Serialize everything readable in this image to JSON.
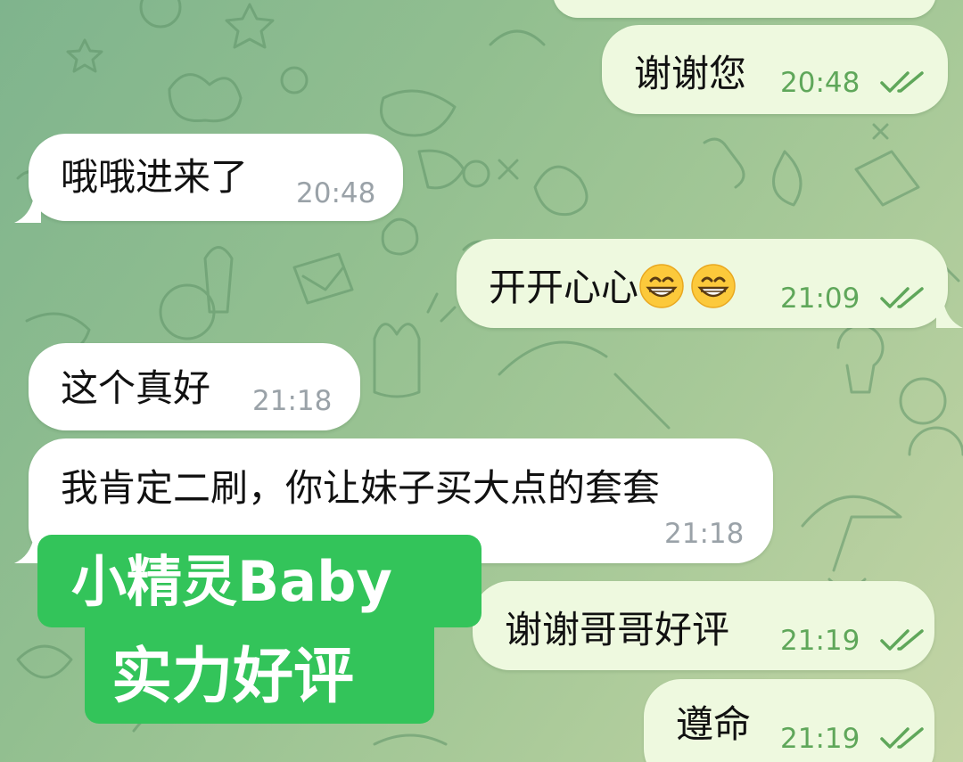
{
  "chat": {
    "messages": [
      {
        "direction": "out",
        "text": "谢谢您",
        "time": "20:48",
        "read": true
      },
      {
        "direction": "in",
        "text": "哦哦进来了",
        "time": "20:48"
      },
      {
        "direction": "out",
        "text": "开开心心",
        "emoji": [
          "grinning-face-with-smiling-eyes",
          "grinning-face-with-smiling-eyes"
        ],
        "time": "21:09",
        "read": true
      },
      {
        "direction": "in",
        "text": "这个真好",
        "time": "21:18"
      },
      {
        "direction": "in",
        "text": "我肯定二刷，你让妹子买大点的套套",
        "time": "21:18"
      },
      {
        "direction": "out",
        "text": "谢谢哥哥好评",
        "time": "21:19",
        "read": true
      },
      {
        "direction": "out",
        "text": "遵命",
        "time": "21:19",
        "read": true
      }
    ]
  },
  "overlay": {
    "line1": "小精灵Baby",
    "line2": "实力好评",
    "color": "#33c45a"
  },
  "colors": {
    "incoming_bubble": "#ffffff",
    "outgoing_bubble": "#eef9df",
    "outgoing_meta": "#5fa75a",
    "incoming_meta": "#9aa2a8"
  }
}
